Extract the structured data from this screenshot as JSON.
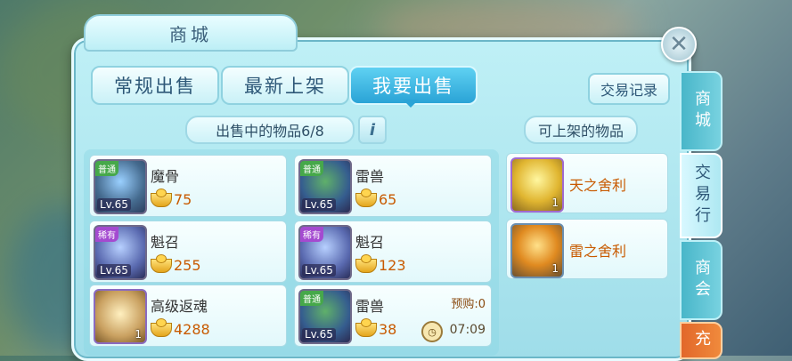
{
  "window": {
    "title": "商城"
  },
  "tabs": [
    {
      "label": "常规出售"
    },
    {
      "label": "最新上架"
    },
    {
      "label": "我要出售"
    }
  ],
  "record_button": "交易记录",
  "left_section": {
    "label": "出售中的物品6/8",
    "info": "i"
  },
  "right_section": {
    "label": "可上架的物品"
  },
  "selling_items": [
    {
      "name": "魔骨",
      "tag": "普通",
      "level": "Lv.65",
      "price": "75"
    },
    {
      "name": "雷兽",
      "tag": "普通",
      "level": "Lv.65",
      "price": "65"
    },
    {
      "name": "魁召",
      "tag": "稀有",
      "level": "Lv.65",
      "price": "255"
    },
    {
      "name": "魁召",
      "tag": "稀有",
      "level": "Lv.65",
      "price": "123"
    },
    {
      "name": "高级返魂",
      "qty": "1",
      "price": "4288"
    },
    {
      "name": "雷兽",
      "tag": "普通",
      "level": "Lv.65",
      "price": "38",
      "preorder": "预购:0",
      "timer": "07:09"
    }
  ],
  "available_items": [
    {
      "name": "天之舍利",
      "qty": "1"
    },
    {
      "name": "雷之舍利",
      "qty": "1"
    }
  ],
  "side_tabs": [
    {
      "label": "商城"
    },
    {
      "label": "交易行"
    },
    {
      "label": "商会"
    },
    {
      "label": "充"
    }
  ],
  "colors": {
    "accent": "#2aa3d6",
    "panel": "#bff0f6",
    "price": "#c85a00"
  }
}
